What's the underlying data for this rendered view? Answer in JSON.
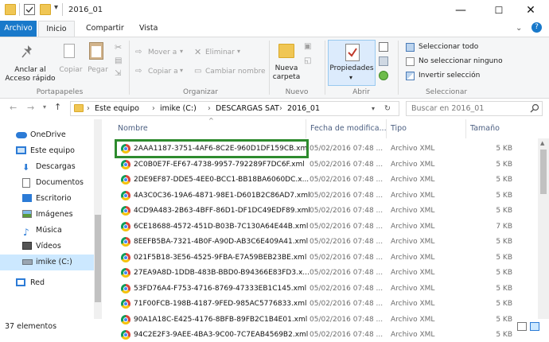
{
  "window": {
    "title": "2016_01",
    "minimize": "—",
    "maximize": "☐",
    "close": "✕"
  },
  "ribbon_tabs": {
    "archivo": "Archivo",
    "inicio": "Inicio",
    "compartir": "Compartir",
    "vista": "Vista"
  },
  "ribbon": {
    "anclar": "Anclar al\nAcceso rápido",
    "copiar": "Copiar",
    "pegar": "Pegar",
    "portapapeles": "Portapapeles",
    "mover_a": "Mover a",
    "copiar_a": "Copiar a",
    "eliminar": "Eliminar",
    "cambiar_nombre": "Cambiar nombre",
    "organizar": "Organizar",
    "nueva_carpeta": "Nueva\ncarpeta",
    "nuevo": "Nuevo",
    "propiedades": "Propiedades",
    "abrir": "Abrir",
    "seleccionar_todo": "Seleccionar todo",
    "no_seleccionar": "No seleccionar ninguno",
    "invertir": "Invertir selección",
    "seleccionar": "Seleccionar"
  },
  "address": {
    "crumbs": [
      "Este equipo",
      "imike (C:)",
      "DESCARGAS SAT",
      "2016_01"
    ],
    "search_placeholder": "Buscar en 2016_01"
  },
  "nav": [
    {
      "label": "OneDrive",
      "icon": "cloud-icon"
    },
    {
      "label": "Este equipo",
      "icon": "computer-icon"
    },
    {
      "label": "Descargas",
      "icon": "download-icon"
    },
    {
      "label": "Documentos",
      "icon": "document-icon"
    },
    {
      "label": "Escritorio",
      "icon": "desktop-icon"
    },
    {
      "label": "Imágenes",
      "icon": "pictures-icon"
    },
    {
      "label": "Música",
      "icon": "music-icon"
    },
    {
      "label": "Vídeos",
      "icon": "video-icon"
    },
    {
      "label": "imike (C:)",
      "icon": "drive-icon"
    },
    {
      "label": "Red",
      "icon": "network-icon"
    }
  ],
  "columns": {
    "name": "Nombre",
    "date": "Fecha de modifica...",
    "type": "Tipo",
    "size": "Tamaño"
  },
  "files": [
    {
      "name": "2AAA1187-3751-4AF6-8C2E-960D1DF159CB.xml",
      "date": "05/02/2016 07:48 ...",
      "type": "Archivo XML",
      "size": "5 KB"
    },
    {
      "name": "2C0B0E7F-EF67-4738-9957-792289F7DC6F.xml",
      "date": "05/02/2016 07:48 ...",
      "type": "Archivo XML",
      "size": "5 KB"
    },
    {
      "name": "2DE9EF87-DDE5-4EE0-BCC1-BB18BA6060DC.x...",
      "date": "05/02/2016 07:48 ...",
      "type": "Archivo XML",
      "size": "5 KB"
    },
    {
      "name": "4A3C0C36-19A6-4871-98E1-D601B2C86AD7.xml",
      "date": "05/02/2016 07:48 ...",
      "type": "Archivo XML",
      "size": "5 KB"
    },
    {
      "name": "4CD9A483-2B63-4BFF-86D1-DF1DC49EDF89.xml",
      "date": "05/02/2016 07:48 ...",
      "type": "Archivo XML",
      "size": "5 KB"
    },
    {
      "name": "6CE18688-4572-451D-B03B-7C130A64E44B.xml",
      "date": "05/02/2016 07:48 ...",
      "type": "Archivo XML",
      "size": "7 KB"
    },
    {
      "name": "8EEFB5BA-7321-4B0F-A90D-AB3C6E409A41.xml",
      "date": "05/02/2016 07:48 ...",
      "type": "Archivo XML",
      "size": "5 KB"
    },
    {
      "name": "021F5B18-3E56-4525-9FBA-E7A59BEB23BE.xml",
      "date": "05/02/2016 07:48 ...",
      "type": "Archivo XML",
      "size": "5 KB"
    },
    {
      "name": "27EA9A8D-1DDB-483B-BBD0-B94366E83FD3.x...",
      "date": "05/02/2016 07:48 ...",
      "type": "Archivo XML",
      "size": "5 KB"
    },
    {
      "name": "53FD76A4-F753-4716-8769-47333EB1C145.xml",
      "date": "05/02/2016 07:48 ...",
      "type": "Archivo XML",
      "size": "5 KB"
    },
    {
      "name": "71F00FCB-198B-4187-9FED-985AC5776833.xml",
      "date": "05/02/2016 07:48 ...",
      "type": "Archivo XML",
      "size": "5 KB"
    },
    {
      "name": "90A1A18C-E425-4176-8BFB-89FB2C1B4E01.xml",
      "date": "05/02/2016 07:48 ...",
      "type": "Archivo XML",
      "size": "5 KB"
    },
    {
      "name": "94C2E2F3-9AEE-4BA3-9C00-7C7EAB4569B2.xml",
      "date": "05/02/2016 07:48 ...",
      "type": "Archivo XML",
      "size": "5 KB"
    }
  ],
  "status": {
    "count": "37 elementos"
  },
  "colors": {
    "accent": "#1979ca",
    "highlight": "#2e8b2e"
  }
}
